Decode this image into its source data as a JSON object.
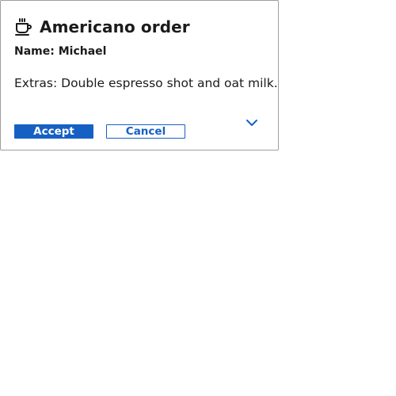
{
  "card": {
    "title": "Americano order",
    "title_icon": "coffee-cup-icon",
    "name_line": "Name: Michael",
    "extras_line": "Extras: Double espresso shot and oat milk.",
    "actions": {
      "accept_label": "Accept",
      "cancel_label": "Cancel",
      "expand_icon": "chevron-down-icon"
    }
  },
  "colors": {
    "accent": "#1660c4",
    "border": "#9e9e9e",
    "text": "#1b1b1b"
  }
}
